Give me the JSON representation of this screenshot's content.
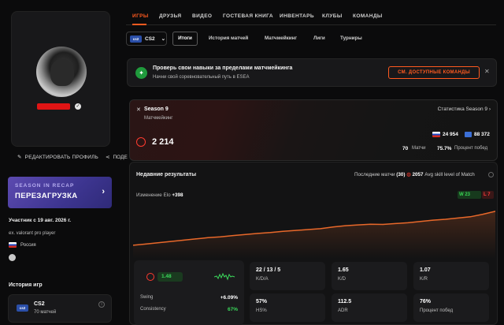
{
  "profile": {
    "edit_profile_label": "РЕДАКТИРОВАТЬ ПРОФИЛЬ",
    "share_label": "ПОДЕ",
    "recap": {
      "sub": "SEASON IN RECAP",
      "title": "ПЕРЕЗАГРУЗКА"
    },
    "member_since": "Участник с 19 авг. 2026 г.",
    "bio": "ex. valorant pro player",
    "country": "Россия",
    "games_history_title": "История игр",
    "games": [
      {
        "logo": "cs2",
        "name": "CS2",
        "matches": "70 матчей"
      }
    ]
  },
  "nav": {
    "items": [
      "ИГРЫ",
      "ДРУЗЬЯ",
      "ВИДЕО",
      "ГОСТЕВАЯ КНИГА",
      "ИНВЕНТАРЬ",
      "КЛУБЫ",
      "КОМАНДЫ"
    ],
    "active": "ИГРЫ"
  },
  "subnav": {
    "game": "CS2",
    "game_logo": "cs2",
    "tabs": [
      "Итоги",
      "История матчей",
      "Матчмейкинг",
      "Лиги",
      "Турниры"
    ],
    "active": "Итоги"
  },
  "banner": {
    "title": "Проверь свои навыки за пределами матчмейкинга",
    "subtitle": "Начни свой соревновательный путь в ESEA",
    "button": "СМ. ДОСТУПНЫЕ КОМАНДЫ",
    "close": "✕"
  },
  "season": {
    "title": "Season 9",
    "subtitle": "Матчмейкинг",
    "stats_link": "Статистика Season 9",
    "elo": "2 214",
    "rank_country": "24 954",
    "rank_global": "88 372",
    "matches_value": "70",
    "matches_label": "Матчи",
    "winrate_value": "75.7%",
    "winrate_label": "Процент побед"
  },
  "recent": {
    "title": "Недавние результаты",
    "last_matches_prefix": "Последние матчи",
    "last_matches_count": "(30)",
    "avg_elo": "2057",
    "avg_label": "Avg skill level of Match",
    "elo_change_label": "Изменение Elo",
    "elo_change_value": "+398",
    "wins": "23",
    "losses": "7",
    "chart_data": {
      "type": "area",
      "title": "",
      "xlabel": "",
      "ylabel": "",
      "x": [
        1,
        2,
        3,
        4,
        5,
        6,
        7,
        8,
        9,
        10,
        11,
        12,
        13,
        14,
        15,
        16,
        17,
        18,
        19,
        20,
        21,
        22,
        23,
        24,
        25,
        26,
        27,
        28,
        29,
        30
      ],
      "values": [
        1816,
        1830,
        1845,
        1860,
        1875,
        1890,
        1905,
        1915,
        1930,
        1942,
        1955,
        1965,
        1980,
        1990,
        2000,
        2010,
        2030,
        2045,
        2055,
        2062,
        2060,
        2070,
        2080,
        2095,
        2110,
        2120,
        2135,
        2150,
        2180,
        2214
      ],
      "ylim": [
        1750,
        2250
      ],
      "grid": false,
      "color": "#e8682a"
    }
  },
  "stats": {
    "swing_elo_value": "1.48",
    "swing_label": "Swing",
    "swing_value": "+6.09%",
    "consistency_label": "Consistency",
    "consistency_value": "67%",
    "tiles": [
      {
        "value": "22 / 13 / 5",
        "label": "K/D/A"
      },
      {
        "value": "1.65",
        "label": "K/D"
      },
      {
        "value": "1.07",
        "label": "K/R"
      },
      {
        "value": "57%",
        "label": "HS%"
      },
      {
        "value": "112.5",
        "label": "ADR"
      },
      {
        "value": "76%",
        "label": "Процент побед"
      }
    ]
  },
  "colors": {
    "accent": "#ff5a1f",
    "win": "#39d353",
    "loss": "#ff3b3b",
    "recap": "#3d3590"
  }
}
